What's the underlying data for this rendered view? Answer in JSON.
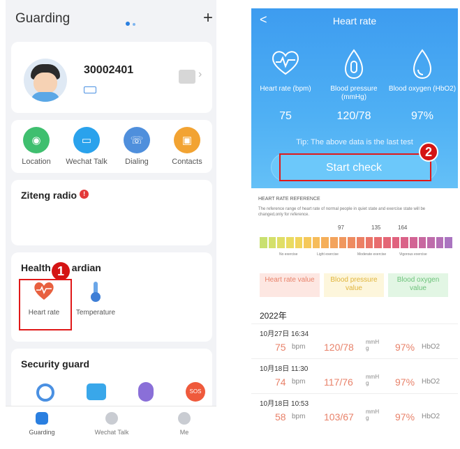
{
  "left": {
    "header": {
      "title": "Guarding",
      "add_icon": "+"
    },
    "device": {
      "id": "30002401"
    },
    "quick_actions": [
      {
        "label": "Location",
        "icon": "location-icon",
        "color": "#3fbf6f"
      },
      {
        "label": "Wechat Talk",
        "icon": "chat-icon",
        "color": "#2aa2ec"
      },
      {
        "label": "Dialing",
        "icon": "phone-icon",
        "color": "#4f8fdc"
      },
      {
        "label": "Contacts",
        "icon": "contacts-icon",
        "color": "#f2a332"
      }
    ],
    "radio": {
      "title": "Ziteng radio",
      "badge": "!"
    },
    "health": {
      "title_part1": "Health",
      "title_part2": "ardian",
      "items": [
        {
          "label": "Heart rate",
          "icon": "heart-rate-icon"
        },
        {
          "label": "Temperature",
          "icon": "thermometer-icon"
        }
      ],
      "marker": "1"
    },
    "security": {
      "title": "Security guard",
      "sos_label": "SOS"
    },
    "tabbar": [
      {
        "label": "Guarding",
        "color": "#2a7fe0"
      },
      {
        "label": "Wechat Talk",
        "color": "#c9ccd2"
      },
      {
        "label": "Me",
        "color": "#c9ccd2"
      }
    ]
  },
  "right": {
    "header": {
      "title": "Heart rate",
      "back": "<"
    },
    "metrics": [
      {
        "label": "Heart rate (bpm)",
        "value": "75"
      },
      {
        "label": "Blood pressure (mmHg)",
        "value": "120/78"
      },
      {
        "label": "Blood oxygen (HbO2)",
        "value": "97%"
      }
    ],
    "tip": "Tip: The above data is the last test",
    "start_button": "Start check",
    "marker": "2",
    "reference": {
      "heading": "HEART RATE REFERENCE",
      "description": "The reference range of heart rate of normal people in quiet state and exercise state will be changed,only for reference.",
      "ticks": [
        "97",
        "135",
        "164"
      ],
      "zones": [
        "No exercise",
        "Light exercise",
        "Moderate exercise",
        "Vigorous exercise"
      ]
    },
    "legend": [
      {
        "label": "Heart rate value",
        "bg": "#fde7e2",
        "color": "#e8826a"
      },
      {
        "label": "Blood pressure value",
        "bg": "#fdf6dc",
        "color": "#e0b43a"
      },
      {
        "label": "Blood oxygen value",
        "bg": "#e2f6e4",
        "color": "#6cc27a"
      }
    ],
    "year": "2022年",
    "records": [
      {
        "date": "10月27日 16:34",
        "hr": "75",
        "hr_unit": "bpm",
        "bp": "120/78",
        "bp_unit": "mmH g",
        "ox": "97%",
        "ox_unit": "HbO2"
      },
      {
        "date": "10月18日 11:30",
        "hr": "74",
        "hr_unit": "bpm",
        "bp": "117/76",
        "bp_unit": "mmH g",
        "ox": "97%",
        "ox_unit": "HbO2"
      },
      {
        "date": "10月18日 10:53",
        "hr": "58",
        "hr_unit": "bpm",
        "bp": "103/67",
        "bp_unit": "mmH g",
        "ox": "97%",
        "ox_unit": "HbO2"
      }
    ]
  }
}
